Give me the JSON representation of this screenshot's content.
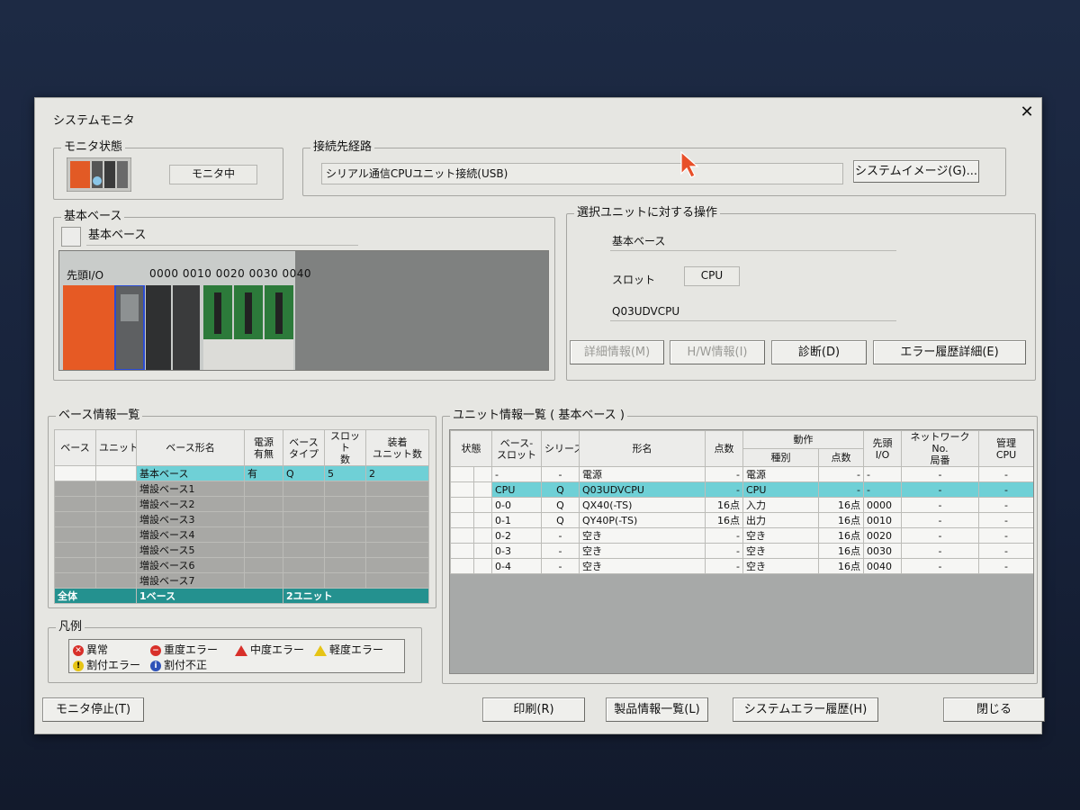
{
  "window": {
    "title": "システムモニタ",
    "close_glyph": "✕"
  },
  "monitor_status": {
    "legend": "モニタ状態",
    "status": "モニタ中"
  },
  "connection": {
    "legend": "接続先経路",
    "path": "シリアル通信CPUユニット接続(USB)",
    "image_button": "システムイメージ(G)..."
  },
  "base": {
    "legend": "基本ベース",
    "base_name": "基本ベース",
    "head_io_label": "先頭I/O",
    "io_addresses": [
      "0000",
      "0010",
      "0020",
      "0030",
      "0040"
    ]
  },
  "unit_ops": {
    "legend": "選択ユニットに対する操作",
    "base_name": "基本ベース",
    "slot_label": "スロット",
    "slot_value": "CPU",
    "model": "Q03UDVCPU",
    "buttons": {
      "detail": "詳細情報(M)",
      "hw": "H/W情報(I)",
      "diag": "診断(D)",
      "error_hist": "エラー履歴詳細(E)"
    }
  },
  "base_list": {
    "legend": "ベース情報一覧",
    "headers": {
      "base": "ベース",
      "unit": "ユニット",
      "name": "ベース形名",
      "power": "電源\n有無",
      "type": "ベース\nタイプ",
      "slots": "スロット\n数",
      "mounted": "装着\nユニット数"
    },
    "rows": [
      {
        "name": "基本ベース",
        "power": "有",
        "type": "Q",
        "slots": "5",
        "mounted": "2",
        "selected": true
      },
      {
        "name": "増設ベース1",
        "power": "",
        "type": "",
        "slots": "",
        "mounted": ""
      },
      {
        "name": "増設ベース2",
        "power": "",
        "type": "",
        "slots": "",
        "mounted": ""
      },
      {
        "name": "増設ベース3",
        "power": "",
        "type": "",
        "slots": "",
        "mounted": ""
      },
      {
        "name": "増設ベース4",
        "power": "",
        "type": "",
        "slots": "",
        "mounted": ""
      },
      {
        "name": "増設ベース5",
        "power": "",
        "type": "",
        "slots": "",
        "mounted": ""
      },
      {
        "name": "増設ベース6",
        "power": "",
        "type": "",
        "slots": "",
        "mounted": ""
      },
      {
        "name": "増設ベース7",
        "power": "",
        "type": "",
        "slots": "",
        "mounted": ""
      }
    ],
    "total": {
      "label": "全体",
      "bases": "1ベース",
      "units": "2ユニット"
    }
  },
  "unit_list": {
    "legend": "ユニット情報一覧 ( 基本ベース )",
    "headers": {
      "status": "状態",
      "slot": "ベース-\nスロット",
      "series": "シリーズ",
      "model": "形名",
      "points": "点数",
      "operation": "動作",
      "op_type": "種別",
      "op_points": "点数",
      "head_io": "先頭\nI/O",
      "network": "ネットワークNo.\n局番",
      "mgmt_cpu": "管理\nCPU"
    },
    "rows": [
      {
        "slot": "-",
        "series": "-",
        "model": "電源",
        "points": "-",
        "op_type": "電源",
        "op_points": "-",
        "head_io": "-",
        "network": "-",
        "mgmt_cpu": "-"
      },
      {
        "slot": "CPU",
        "series": "Q",
        "model": "Q03UDVCPU",
        "points": "-",
        "op_type": "CPU",
        "op_points": "-",
        "head_io": "-",
        "network": "-",
        "mgmt_cpu": "-",
        "selected": true
      },
      {
        "slot": "0-0",
        "series": "Q",
        "model": "QX40(-TS)",
        "points": "16点",
        "op_type": "入力",
        "op_points": "16点",
        "head_io": "0000",
        "network": "-",
        "mgmt_cpu": "-"
      },
      {
        "slot": "0-1",
        "series": "Q",
        "model": "QY40P(-TS)",
        "points": "16点",
        "op_type": "出力",
        "op_points": "16点",
        "head_io": "0010",
        "network": "-",
        "mgmt_cpu": "-"
      },
      {
        "slot": "0-2",
        "series": "-",
        "model": "空き",
        "points": "-",
        "op_type": "空き",
        "op_points": "16点",
        "head_io": "0020",
        "network": "-",
        "mgmt_cpu": "-"
      },
      {
        "slot": "0-3",
        "series": "-",
        "model": "空き",
        "points": "-",
        "op_type": "空き",
        "op_points": "16点",
        "head_io": "0030",
        "network": "-",
        "mgmt_cpu": "-"
      },
      {
        "slot": "0-4",
        "series": "-",
        "model": "空き",
        "points": "-",
        "op_type": "空き",
        "op_points": "16点",
        "head_io": "0040",
        "network": "-",
        "mgmt_cpu": "-"
      }
    ]
  },
  "legend_box": {
    "legend": "凡例",
    "items": [
      {
        "label": "異常",
        "icon": "error-x-icon",
        "color": "#d8302a"
      },
      {
        "label": "重度エラー",
        "icon": "major-error-icon",
        "color": "#d8302a"
      },
      {
        "label": "中度エラー",
        "icon": "moderate-error-icon",
        "color": "#d8302a"
      },
      {
        "label": "軽度エラー",
        "icon": "minor-error-icon",
        "color": "#e6c415"
      },
      {
        "label": "割付エラー",
        "icon": "assignment-error-icon",
        "color": "#e6c415"
      },
      {
        "label": "割付不正",
        "icon": "assignment-invalid-icon",
        "color": "#2e52b8"
      }
    ]
  },
  "footer": {
    "stop_monitor": "モニタ停止(T)",
    "print": "印刷(R)",
    "product_info": "製品情報一覧(L)",
    "system_error_hist": "システムエラー履歴(H)",
    "close": "閉じる"
  }
}
